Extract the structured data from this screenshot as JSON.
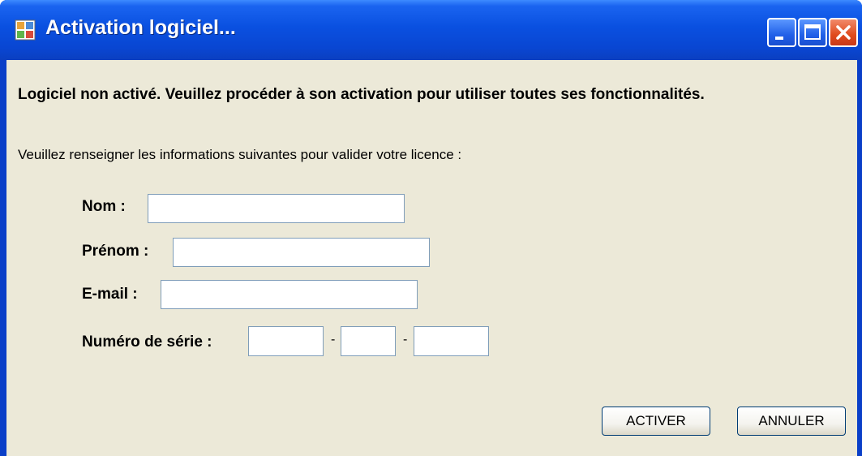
{
  "window": {
    "title": "Activation logiciel...",
    "controls": {
      "minimize": "minimize-icon",
      "maximize": "maximize-icon",
      "close": "close-icon"
    }
  },
  "message": {
    "headline": "Logiciel non activé. Veuillez procéder à son activation pour utiliser toutes ses fonctionnalités.",
    "instructions": "Veuillez renseigner les informations suivantes pour valider votre licence :"
  },
  "form": {
    "nom_label": "Nom :",
    "nom_value": "",
    "prenom_label": "Prénom :",
    "prenom_value": "",
    "email_label": "E-mail :",
    "email_value": "",
    "serial_label": "Numéro de série :",
    "serial_separator": "-",
    "serial_parts": [
      "",
      "",
      ""
    ]
  },
  "buttons": {
    "activate": "ACTIVER",
    "cancel": "ANNULER"
  },
  "colors": {
    "titlebar": "#0a50e0",
    "client_background": "#ece9d8",
    "close_button": "#e04a1c"
  }
}
